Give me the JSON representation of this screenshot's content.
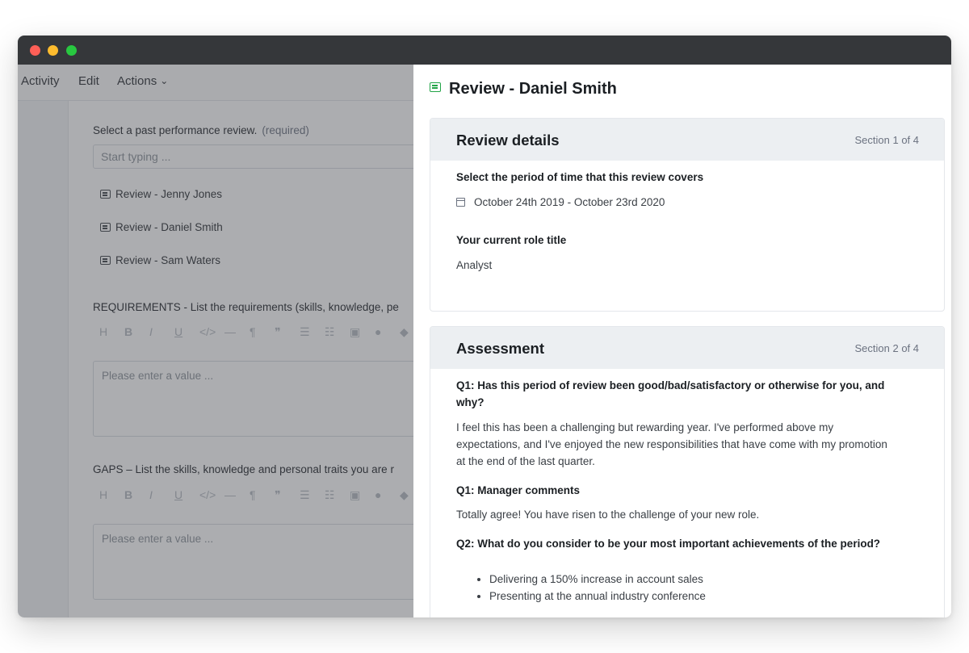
{
  "menubar": {
    "activity": "Activity",
    "edit": "Edit",
    "actions": "Actions"
  },
  "form": {
    "select_label": "Select a past performance review.",
    "required": "(required)",
    "search_placeholder": "Start typing ...",
    "reviews": [
      "Review - Jenny Jones",
      "Review - Daniel Smith",
      "Review - Sam Waters"
    ],
    "requirements_label": "REQUIREMENTS - List the requirements (skills, knowledge, pe",
    "gaps_label": "GAPS – List the skills, knowledge and personal traits you are r",
    "value_placeholder": "Please enter a value ..."
  },
  "toolbar_icons": [
    "heading-icon",
    "bold-icon",
    "italic-icon",
    "underline-icon",
    "code-icon",
    "horizontal-rule-icon",
    "paragraph-icon",
    "quote-icon",
    "bullet-list-icon",
    "numbered-list-icon",
    "image-icon",
    "user-icon",
    "color-icon"
  ],
  "drawer": {
    "title": "Review - Daniel Smith",
    "section1": {
      "title": "Review details",
      "section": "Section 1 of 4",
      "period_label": "Select the period of time that this review covers",
      "period_value": "October 24th 2019 - October 23rd 2020",
      "role_label": "Your current role title",
      "role_value": "Analyst"
    },
    "section2": {
      "title": "Assessment",
      "section": "Section 2 of 4",
      "q1_line1": "Q1: Has this period of review been good/bad/satisfactory or otherwise for you, and",
      "q1_line2": "why?",
      "a1_line1": "I feel this has been a challenging but rewarding year. I've performed above my",
      "a1_line2": "expectations, and I've enjoyed the new responsibilities that have come with my promotion",
      "a1_line3": "at the end of the last quarter.",
      "q1_manager": "Q1: Manager comments",
      "a1_manager": "Totally agree! You have risen to the challenge of your new role.",
      "q2": "Q2: What do you consider to be your most important achievements of the period?",
      "achievements": [
        "Delivering a 150% increase in account sales",
        "Presenting at the annual industry conference"
      ]
    }
  },
  "colors": {
    "titlebar": "#35373a",
    "accent_green": "#22a447",
    "card_header": "#eceff2"
  }
}
